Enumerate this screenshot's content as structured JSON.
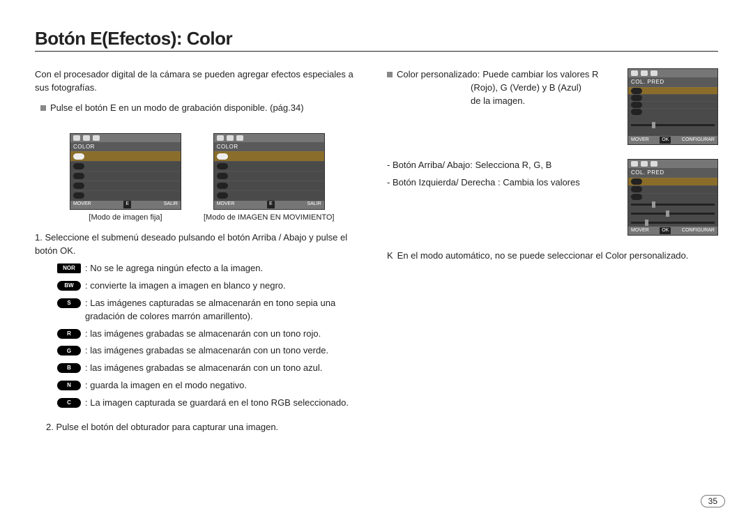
{
  "title": "Botón E(Efectos): Color",
  "left": {
    "intro": "Con el procesador digital de la cámara se pueden agregar efectos especiales a sus fotografías.",
    "bullet": "Pulse el botón E en un modo de grabación disponible. (pág.34)",
    "captions": {
      "a": "[Modo de imagen fija]",
      "b": "[Modo de IMAGEN EN MOVIMIENTO]"
    },
    "lcd": {
      "header": "COLOR",
      "footer_left": "MOVER",
      "footer_btn": "E",
      "footer_right": "SALIR"
    },
    "step1": "1. Seleccione el submenú deseado pulsando el botón Arriba / Abajo y pulse el botón OK.",
    "effects": [
      {
        "label": "NOR",
        "shape": "rect",
        "text": ": No se le agrega ningún efecto a la imagen."
      },
      {
        "label": "BW",
        "shape": "pill",
        "text": ": convierte la imagen a imagen en blanco y negro."
      },
      {
        "label": "S",
        "shape": "pill",
        "text": ": Las imágenes capturadas se almacenarán en tono sepia una gradación de colores marrón amarillento)."
      },
      {
        "label": "R",
        "shape": "pill",
        "text": ": las imágenes grabadas se almacenarán con un tono rojo."
      },
      {
        "label": "G",
        "shape": "pill",
        "text": ": las imágenes grabadas se almacenarán con un tono verde."
      },
      {
        "label": "B",
        "shape": "pill",
        "text": ": las imágenes grabadas se almacenarán con un tono azul."
      },
      {
        "label": "N",
        "shape": "pill",
        "text": ": guarda la imagen en el modo negativo."
      },
      {
        "label": "C",
        "shape": "pill",
        "text": ": La imagen capturada se guardará en el tono RGB seleccionado."
      }
    ],
    "step2": "2. Pulse el botón del obturador para capturar una imagen."
  },
  "right": {
    "custom_label": "Color personalizado:",
    "custom_desc_l1": "Puede cambiar los valores R",
    "custom_desc_l2": "(Rojo), G (Verde) y  B (Azul)",
    "custom_desc_l3": "de la imagen.",
    "lcd": {
      "header": "COL. PRED",
      "footer_left": "MOVER",
      "footer_btn": "OK",
      "footer_right": "CONFIGURAR"
    },
    "line_a": "- Botón Arriba/ Abajo: Selecciona R, G, B",
    "line_b": "- Botón Izquierda/ Derecha : Cambia los valores",
    "note_k": "K",
    "note": "En el modo automático, no se puede seleccionar el Color personalizado."
  },
  "page_number": "35"
}
